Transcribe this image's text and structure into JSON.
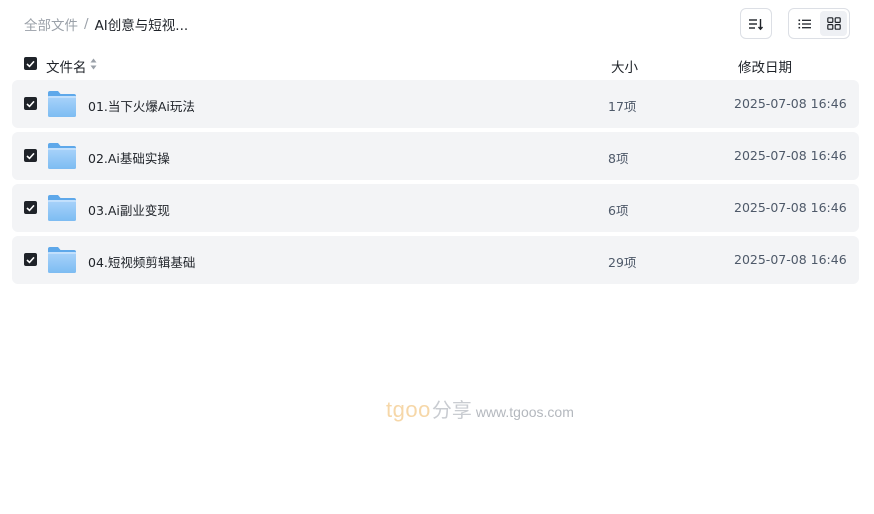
{
  "breadcrumb": {
    "root": "全部文件",
    "separator": "/",
    "current": "AI创意与短视..."
  },
  "toolbar": {
    "sort_icon": "sort-lines-icon",
    "list_view_icon": "list-view-icon",
    "grid_view_icon": "grid-view-icon",
    "active_view": "list"
  },
  "header": {
    "name": "文件名",
    "size": "大小",
    "date": "修改日期",
    "all_checked": true
  },
  "rows": [
    {
      "name": "01.当下火爆Ai玩法",
      "size": "17项",
      "date": "2025-07-08 16:46",
      "checked": true
    },
    {
      "name": "02.Ai基础实操",
      "size": "8项",
      "date": "2025-07-08 16:46",
      "checked": true
    },
    {
      "name": "03.Ai副业变现",
      "size": "6项",
      "date": "2025-07-08 16:46",
      "checked": true
    },
    {
      "name": "04.短视频剪辑基础",
      "size": "29项",
      "date": "2025-07-08 16:46",
      "checked": true
    }
  ],
  "watermark": {
    "brand": "tgoo",
    "share": "分享",
    "url": "www.tgoos.com"
  },
  "colors": {
    "row_bg": "#f3f4f6",
    "checkbox": "#1f2329",
    "folder_light": "#b9dcfb",
    "folder_dark": "#6cb2f0",
    "watermark_brand": "#f6d7a8"
  }
}
